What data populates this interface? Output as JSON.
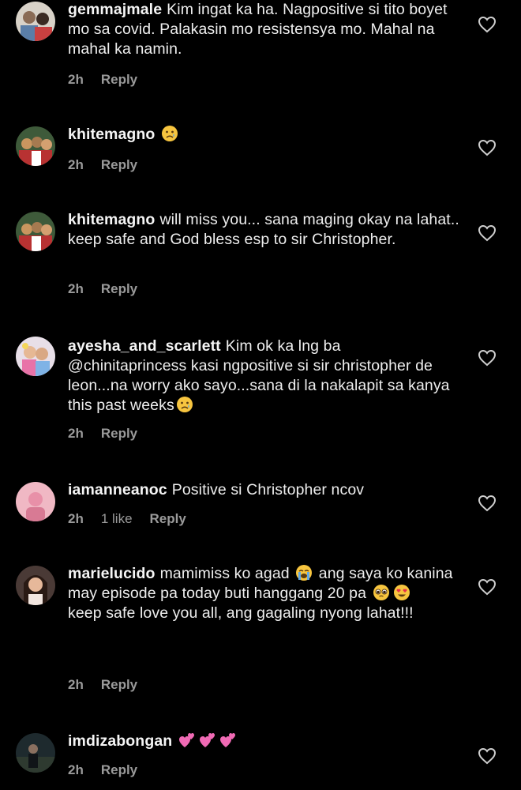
{
  "comments": [
    {
      "username": "gemmajmale",
      "text": "Kim ingat ka ha. Nagpositive si tito boyet mo sa covid. Palakasin mo resistensya mo. Mahal na mahal ka namin.",
      "time": "2h",
      "likes": "",
      "reply": "Reply",
      "avatar_icon": "couple-photo-avatar"
    },
    {
      "username": "khitemagno",
      "text": "",
      "emoji": [
        "sad-tear-emoji"
      ],
      "time": "2h",
      "likes": "",
      "reply": "Reply",
      "avatar_icon": "group-photo-avatar"
    },
    {
      "username": "khitemagno",
      "text": "will miss you... sana maging okay na lahat.. keep safe and God bless esp to sir Christopher.",
      "time": "2h",
      "likes": "",
      "reply": "Reply",
      "avatar_icon": "group-photo-avatar"
    },
    {
      "username": "ayesha_and_scarlett",
      "text": "Kim ok ka lng ba @chinitaprincess kasi ngpositive si sir christopher de leon...na worry ako sayo...sana di la nakalapit sa kanya this past weeks",
      "emoji": [
        "sad-tear-emoji"
      ],
      "time": "2h",
      "likes": "",
      "reply": "Reply",
      "avatar_icon": "kids-photo-avatar"
    },
    {
      "username": "iamanneanoc",
      "text": "Positive si Christopher ncov",
      "time": "2h",
      "likes": "1 like",
      "reply": "Reply",
      "avatar_icon": "pink-photo-avatar"
    },
    {
      "username": "marielucido",
      "text_parts": [
        "mamimiss ko agad",
        "ang saya ko kanina may episode pa today buti hanggang 20 pa",
        "keep safe love you all, ang gagaling nyong lahat!!!"
      ],
      "time": "2h",
      "likes": "",
      "reply": "Reply",
      "avatar_icon": "woman-photo-avatar"
    },
    {
      "username": "imdizabongan",
      "text": "",
      "emoji": [
        "two-hearts-emoji",
        "two-hearts-emoji",
        "two-hearts-emoji"
      ],
      "time": "2h",
      "likes": "",
      "reply": "Reply",
      "avatar_icon": "dark-photo-avatar"
    }
  ],
  "colors": {
    "background": "#000000",
    "text": "#eeeeee",
    "meta": "#9a9a9a"
  }
}
